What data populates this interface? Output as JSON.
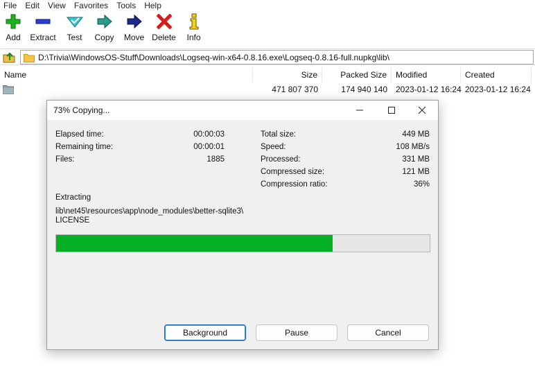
{
  "menu": [
    "File",
    "Edit",
    "View",
    "Favorites",
    "Tools",
    "Help"
  ],
  "toolbar": {
    "add": "Add",
    "extract": "Extract",
    "test": "Test",
    "copy": "Copy",
    "move": "Move",
    "delete": "Delete",
    "info": "Info"
  },
  "address": {
    "path": "D:\\Trivia\\WindowsOS-Stuff\\Downloads\\Logseq-win-x64-0.8.16.exe\\Logseq-0.8.16-full.nupkg\\lib\\"
  },
  "columns": {
    "name": "Name",
    "size": "Size",
    "packed": "Packed Size",
    "modified": "Modified",
    "created": "Created"
  },
  "rows": [
    {
      "name": "",
      "size": "471 807 370",
      "packed": "174 940 140",
      "modified": "2023-01-12 16:24",
      "created": "2023-01-12 16:24"
    }
  ],
  "dialog": {
    "title": "73% Copying...",
    "elapsed_label": "Elapsed time:",
    "elapsed_value": "00:00:03",
    "remaining_label": "Remaining time:",
    "remaining_value": "00:00:01",
    "files_label": "Files:",
    "files_value": "1885",
    "total_size_label": "Total size:",
    "total_size_value": "449 MB",
    "speed_label": "Speed:",
    "speed_value": "108 MB/s",
    "processed_label": "Processed:",
    "processed_value": "331 MB",
    "compressed_label": "Compressed size:",
    "compressed_value": "121 MB",
    "ratio_label": "Compression ratio:",
    "ratio_value": "36%",
    "operation": "Extracting",
    "current_path": "lib\\net45\\resources\\app\\node_modules\\better-sqlite3\\",
    "current_file": "LICENSE",
    "progress_fraction": 0.74,
    "background_button": "Background",
    "pause_button": "Pause",
    "cancel_button": "Cancel"
  },
  "colors": {
    "progress_fill": "#06b025",
    "primary_button_border": "#1f6fc4"
  },
  "icons": {
    "add": "plus-icon",
    "extract": "minus-icon",
    "test": "check-icon",
    "copy": "arrow-right-icon",
    "move": "arrow-right-icon",
    "delete": "x-icon",
    "info": "info-icon"
  }
}
